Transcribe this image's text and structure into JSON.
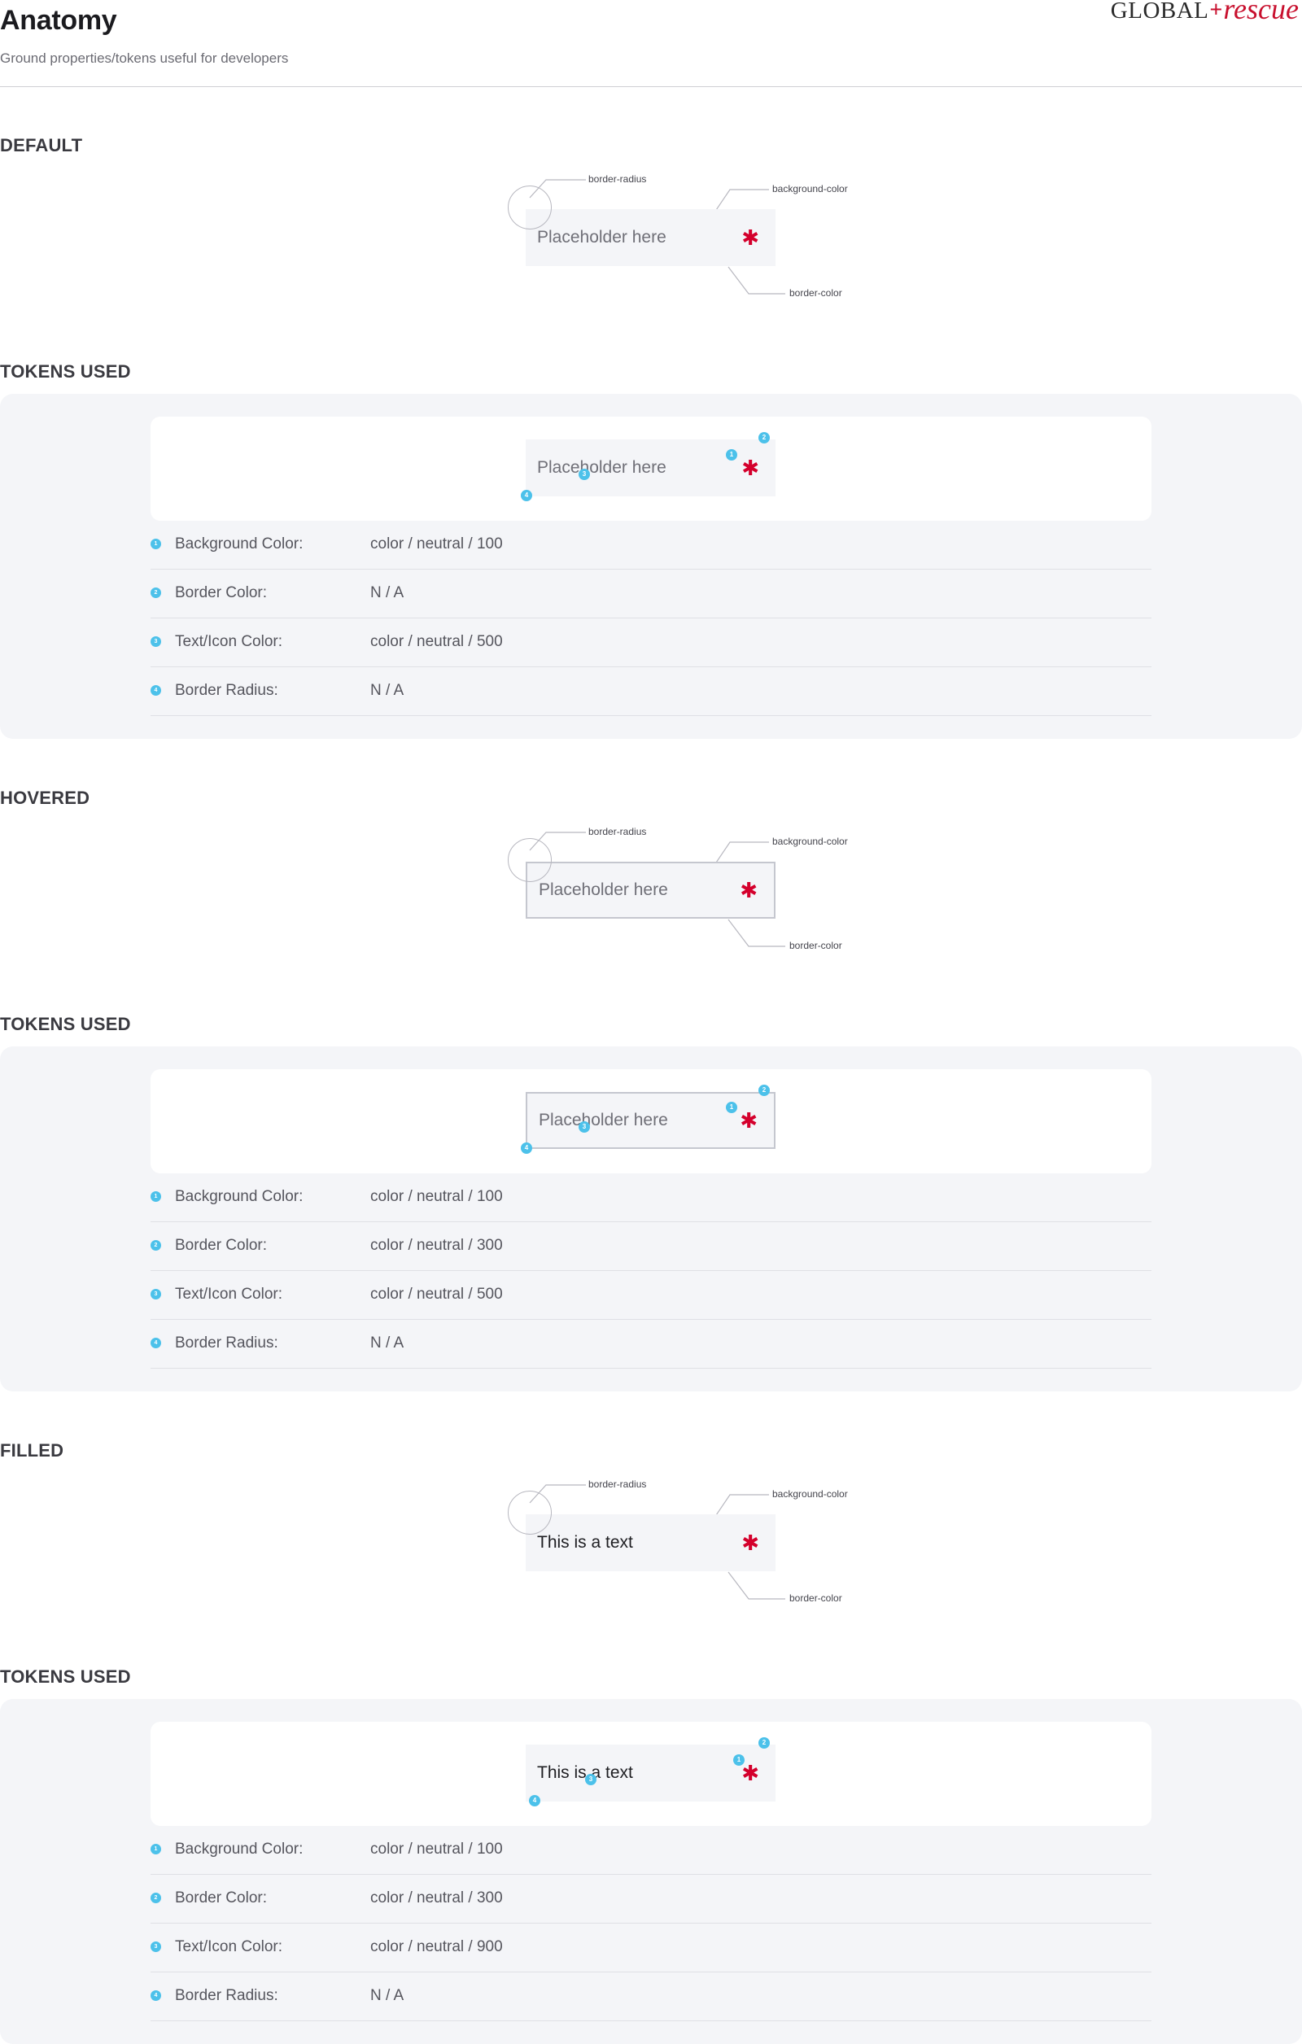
{
  "header": {
    "title": "Anatomy",
    "subtitle": "Ground properties/tokens useful for developers",
    "logo": {
      "global": "GLOBAL",
      "cross": "+",
      "rescue": "rescue"
    }
  },
  "callouts": {
    "border_radius": "border-radius",
    "background_color": "background-color",
    "border_color": "border-color"
  },
  "tokens_heading": "TOKENS USED",
  "token_labels": [
    "Background Color:",
    "Border Color:",
    "Text/Icon Color:",
    "Border Radius:"
  ],
  "marker_numbers": [
    "1",
    "2",
    "3",
    "4"
  ],
  "required_marker": "✱",
  "accent_colors": {
    "marker": "#4cc1ea",
    "required": "#d4002c",
    "brand": "#c8102e"
  },
  "states": [
    {
      "heading": "DEFAULT",
      "input_text": "Placeholder here",
      "filled": false,
      "bordered": false,
      "tokens": [
        "color / neutral / 100",
        "N / A",
        "color / neutral / 500",
        "N / A"
      ]
    },
    {
      "heading": "HOVERED",
      "input_text": "Placeholder here",
      "filled": false,
      "bordered": true,
      "tokens": [
        "color / neutral / 100",
        "color / neutral / 300",
        "color / neutral / 500",
        "N / A"
      ]
    },
    {
      "heading": "FILLED",
      "input_text": "This is a text",
      "filled": true,
      "bordered": false,
      "tokens": [
        "color / neutral / 100",
        "color / neutral / 300",
        "color / neutral / 900",
        "N / A"
      ]
    }
  ]
}
